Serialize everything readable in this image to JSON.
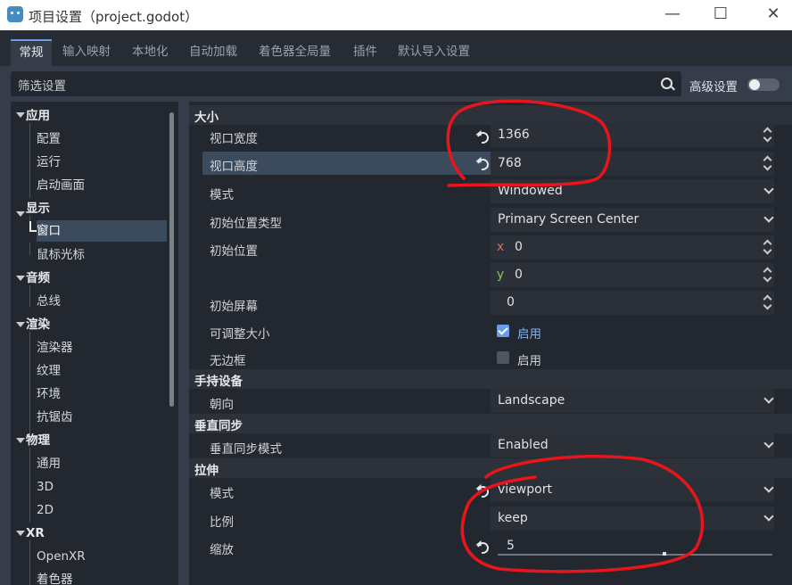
{
  "window": {
    "title": "项目设置（project.godot）",
    "controls": [
      "—",
      "☐",
      "✕"
    ]
  },
  "tabs": [
    {
      "label": "常规",
      "active": true
    },
    {
      "label": "输入映射"
    },
    {
      "label": "本地化"
    },
    {
      "label": "自动加载"
    },
    {
      "label": "着色器全局量"
    },
    {
      "label": "插件"
    },
    {
      "label": "默认导入设置"
    }
  ],
  "filter": {
    "placeholder": "筛选设置",
    "advanced_label": "高级设置",
    "advanced_on": false
  },
  "tree": [
    {
      "label": "应用",
      "category": true
    },
    {
      "label": "配置"
    },
    {
      "label": "运行"
    },
    {
      "label": "启动画面"
    },
    {
      "label": "显示",
      "category": true
    },
    {
      "label": "窗口",
      "selected": true
    },
    {
      "label": "鼠标光标"
    },
    {
      "label": "音频",
      "category": true
    },
    {
      "label": "总线"
    },
    {
      "label": "渲染",
      "category": true
    },
    {
      "label": "渲染器"
    },
    {
      "label": "纹理"
    },
    {
      "label": "环境"
    },
    {
      "label": "抗锯齿"
    },
    {
      "label": "物理",
      "category": true
    },
    {
      "label": "通用"
    },
    {
      "label": "3D"
    },
    {
      "label": "2D"
    },
    {
      "label": "XR",
      "category": true
    },
    {
      "label": "OpenXR"
    },
    {
      "label": "着色器"
    }
  ],
  "sections": {
    "size": "大小",
    "handheld": "手持设备",
    "vsync": "垂直同步",
    "stretch": "拉伸"
  },
  "settings": {
    "viewport_width": {
      "label": "视口宽度",
      "value": "1366"
    },
    "viewport_height": {
      "label": "视口高度",
      "value": "768"
    },
    "mode": {
      "label": "模式",
      "value": "Windowed"
    },
    "initial_position_type": {
      "label": "初始位置类型",
      "value": "Primary Screen Center"
    },
    "initial_position": {
      "label": "初始位置",
      "x_axis": "x",
      "x": "0",
      "y_axis": "y",
      "y": "0"
    },
    "initial_screen": {
      "label": "初始屏幕",
      "value": "0"
    },
    "resizable": {
      "label": "可调整大小",
      "checkbox_label": "启用",
      "checked": true
    },
    "borderless": {
      "label": "无边框",
      "checkbox_label": "启用",
      "checked": false
    },
    "orientation": {
      "label": "朝向",
      "value": "Landscape"
    },
    "vsync_mode": {
      "label": "垂直同步模式",
      "value": "Enabled"
    },
    "stretch_mode": {
      "label": "模式",
      "value": "viewport"
    },
    "stretch_aspect": {
      "label": "比例",
      "value": "keep"
    },
    "stretch_scale": {
      "label": "缩放",
      "value": "5"
    }
  },
  "colors": {
    "accent": "#699ce8",
    "annotation": "#e8151b"
  }
}
